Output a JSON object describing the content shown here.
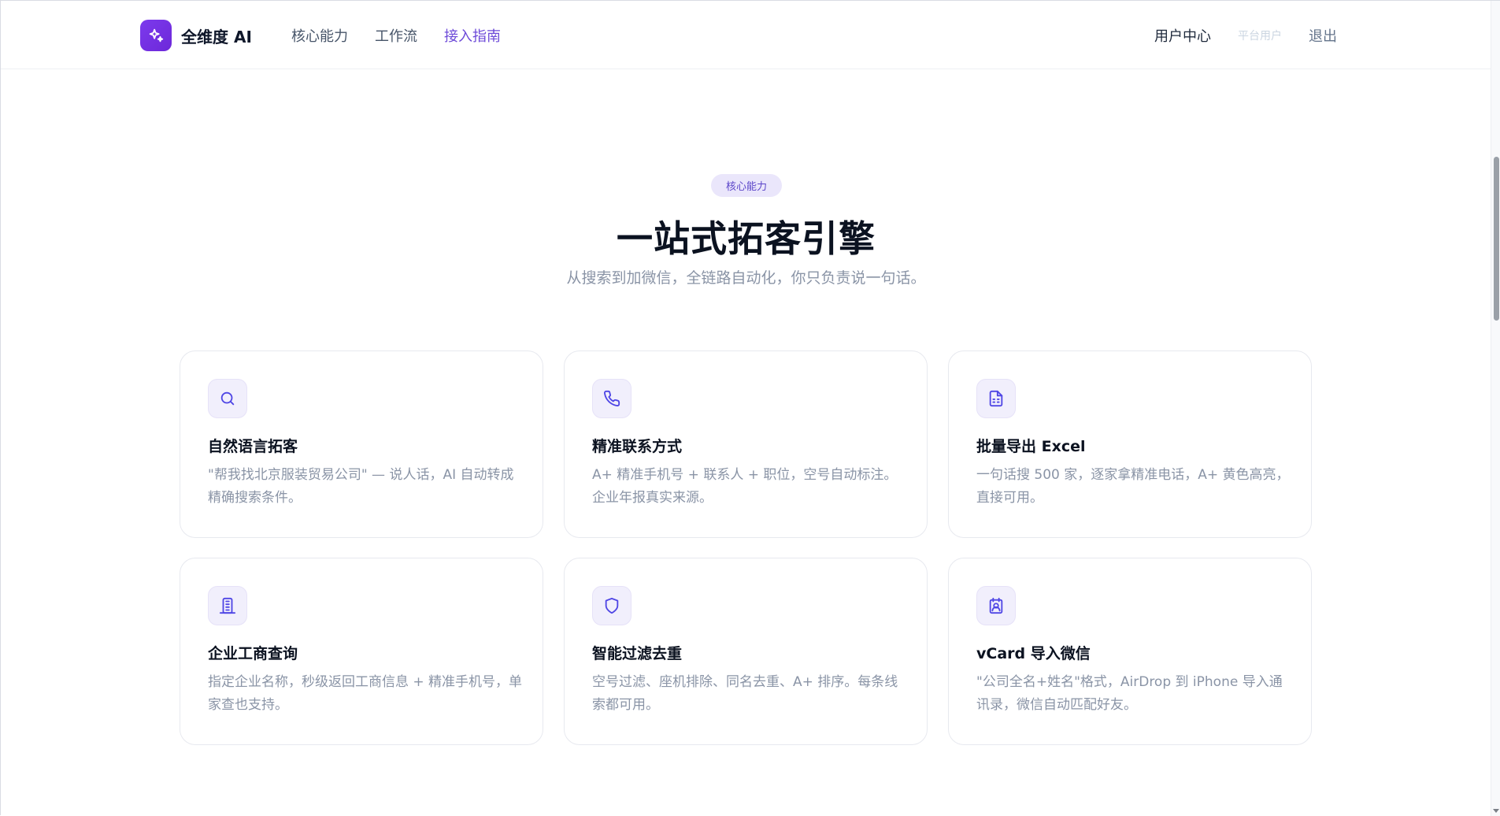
{
  "header": {
    "brand_name": "全维度 AI",
    "nav": [
      {
        "label": "核心能力"
      },
      {
        "label": "工作流"
      },
      {
        "label": "接入指南"
      }
    ],
    "user_center": "用户中心",
    "role": "平台用户",
    "logout": "退出"
  },
  "section": {
    "pill": "核心能力",
    "title": "一站式拓客引擎",
    "subtitle": "从搜索到加微信，全链路自动化，你只负责说一句话。"
  },
  "cards": [
    {
      "icon": "search-icon",
      "title": "自然语言拓客",
      "desc": "\"帮我找北京服装贸易公司\" — 说人话，AI 自动转成精确搜索条件。"
    },
    {
      "icon": "phone-icon",
      "title": "精准联系方式",
      "desc": "A+ 精准手机号 + 联系人 + 职位，空号自动标注。企业年报真实来源。"
    },
    {
      "icon": "document-icon",
      "title": "批量导出 Excel",
      "desc": "一句话搜 500 家，逐家拿精准电话，A+ 黄色高亮，直接可用。"
    },
    {
      "icon": "building-icon",
      "title": "企业工商查询",
      "desc": "指定企业名称，秒级返回工商信息 + 精准手机号，单家查也支持。"
    },
    {
      "icon": "shield-icon",
      "title": "智能过滤去重",
      "desc": "空号过滤、座机排除、同名去重、A+ 排序。每条线索都可用。"
    },
    {
      "icon": "contact-card-icon",
      "title": "vCard 导入微信",
      "desc": "\"公司全名+姓名\"格式，AirDrop 到 iPhone 导入通讯录，微信自动匹配好友。"
    }
  ],
  "colors": {
    "accent": "#6d4ad8",
    "logo": "#7c3aed",
    "muted_text": "#8a94a6"
  }
}
